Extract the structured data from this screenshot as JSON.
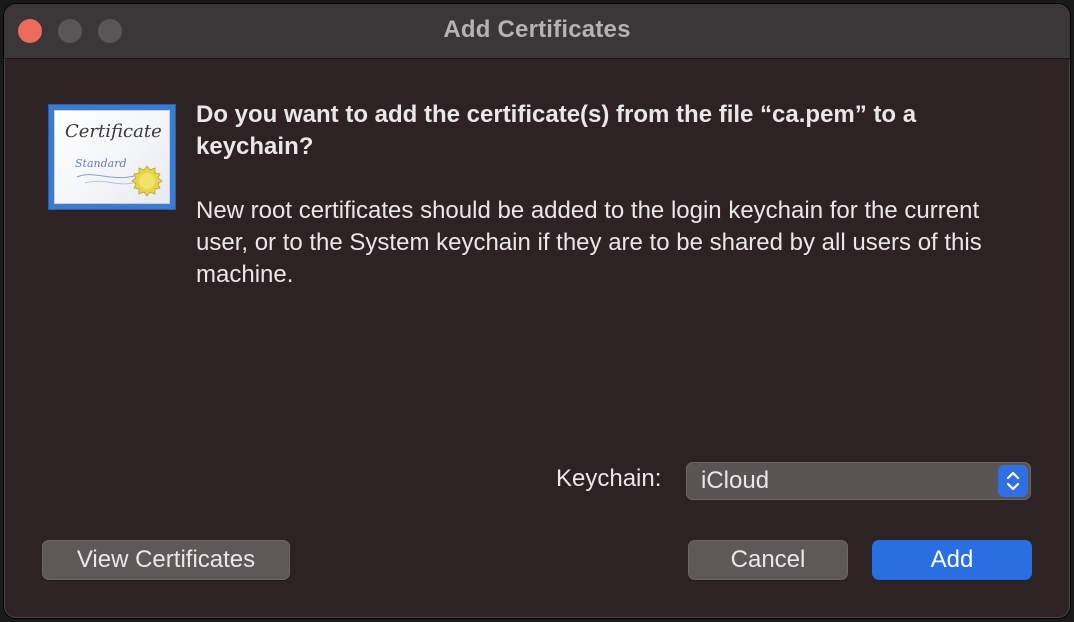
{
  "window": {
    "title": "Add Certificates"
  },
  "certificate_icon": {
    "title": "Certificate",
    "subtitle": "Standard"
  },
  "message": {
    "headline": "Do you want to add the certificate(s) from the file “ca.pem” to a keychain?",
    "body": "New root certificates should be added to the login keychain for the current user, or to the System keychain if they are to be shared by all users of this machine."
  },
  "keychain": {
    "label": "Keychain:",
    "selected": "iCloud"
  },
  "buttons": {
    "view_certificates": "View Certificates",
    "cancel": "Cancel",
    "add": "Add"
  },
  "colors": {
    "window_bg": "#2d2224",
    "titlebar_bg": "#3b3637",
    "close": "#ed6a5e",
    "accent": "#2a6fe2"
  },
  "icons": [
    "close-icon",
    "minimize-icon",
    "maximize-icon",
    "certificate-icon",
    "stepper-updown-icon"
  ]
}
